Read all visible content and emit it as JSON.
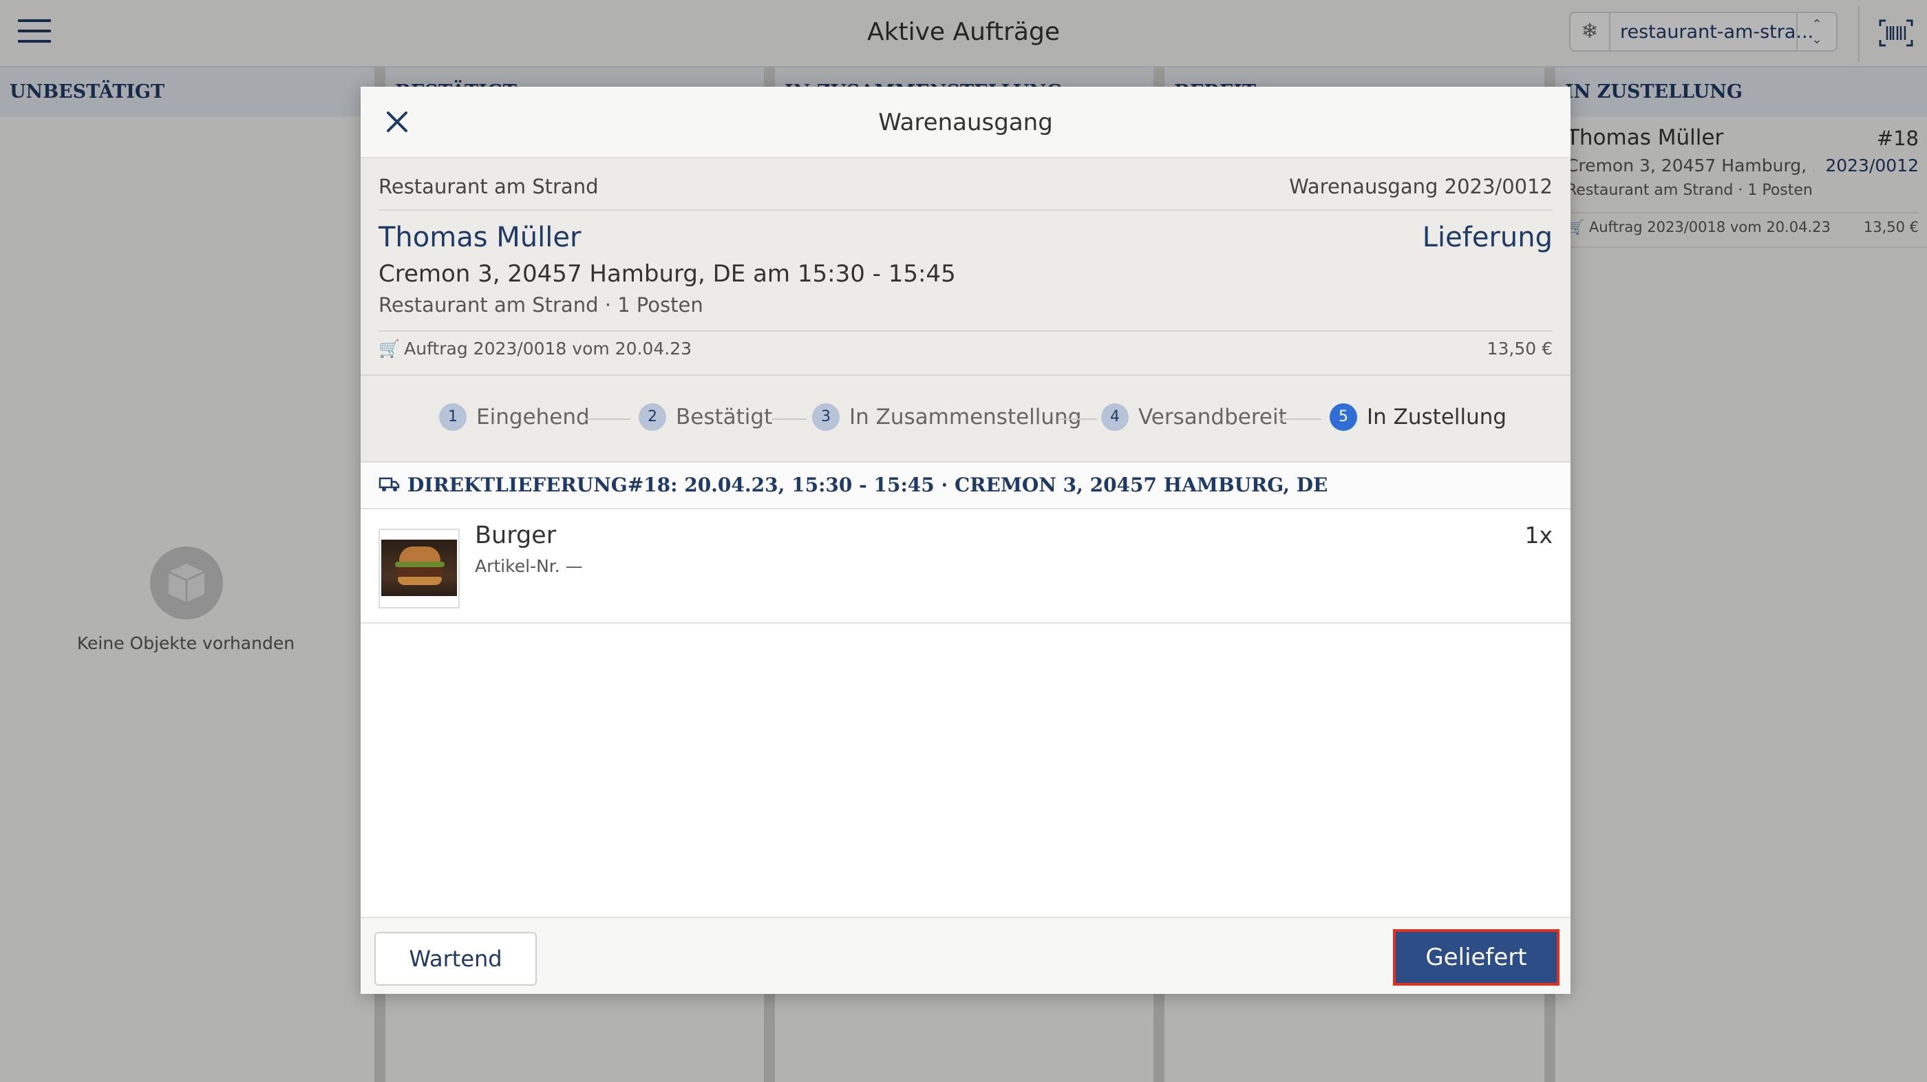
{
  "app": {
    "title": "Aktive Aufträge",
    "store_selector_value": "restaurant-am-stra...",
    "icons": {
      "menu": "hamburger-menu-icon",
      "store": "snowflake-icon",
      "stepper": "chevron-updown-icon",
      "scanner": "barcode-scanner-icon"
    }
  },
  "columns": [
    {
      "title": "UNBESTÄTIGT"
    },
    {
      "title": "BESTÄTIGT"
    },
    {
      "title": "IN ZUSAMMENSTELLUNG"
    },
    {
      "title": "BEREIT"
    },
    {
      "title": "IN ZUSTELLUNG"
    }
  ],
  "empty_state": {
    "text": "Keine Objekte vorhanden",
    "icon": "box-icon"
  },
  "order_card": {
    "name": "Thomas Müller",
    "number": "#18",
    "address": "Cremon 3, 20457 Hamburg, ...",
    "reference": "2023/0012",
    "meta": "Restaurant am Strand · 1 Posten",
    "order": "Auftrag 2023/0018 vom 20.04.23",
    "price": "13,50 €"
  },
  "modal": {
    "title": "Warenausgang",
    "store": "Restaurant am Strand",
    "reference": "Warenausgang 2023/0012",
    "customer_name": "Thomas Müller",
    "delivery_type": "Lieferung",
    "address_time": "Cremon 3, 20457 Hamburg, DE am 15:30 - 15:45",
    "sub": "Restaurant am Strand · 1 Posten",
    "order": "Auftrag 2023/0018 vom 20.04.23",
    "price": "13,50 €",
    "steps": [
      {
        "num": "1",
        "label": "Eingehend"
      },
      {
        "num": "2",
        "label": "Bestätigt"
      },
      {
        "num": "3",
        "label": "In Zusammenstellung"
      },
      {
        "num": "4",
        "label": "Versandbereit"
      },
      {
        "num": "5",
        "label": "In Zustellung"
      }
    ],
    "active_step": 5,
    "shipment": "DIREKTLIEFERUNG#18: 20.04.23, 15:30 - 15:45 · CREMON 3, 20457 HAMBURG, DE",
    "items": [
      {
        "name": "Burger",
        "sku": "Artikel-Nr. —",
        "qty": "1x"
      }
    ],
    "buttons": {
      "wait": "Wartend",
      "done": "Geliefert"
    }
  },
  "colors": {
    "brand_navy": "#1f3a66",
    "active_step": "#2e6ed6",
    "primary_button": "#2d4d86",
    "highlight_border": "#e0301e"
  }
}
